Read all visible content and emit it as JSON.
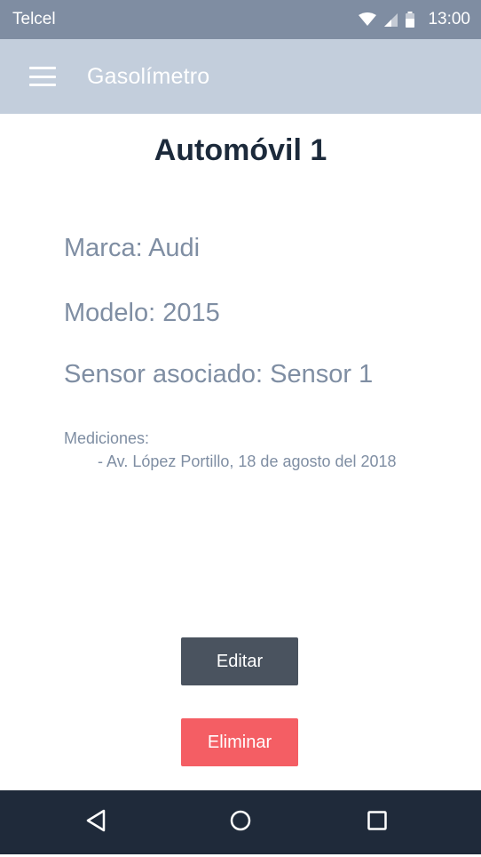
{
  "status_bar": {
    "carrier": "Telcel",
    "time": "13:00",
    "icons": [
      "wifi-icon",
      "signal-icon",
      "battery-icon"
    ]
  },
  "app_bar": {
    "menu_icon": "hamburger-menu-icon",
    "title": "Gasolímetro"
  },
  "main": {
    "title": "Automóvil 1",
    "marca": "Marca: Audi",
    "modelo": "Modelo: 2015",
    "sensor": "Sensor asociado: Sensor 1",
    "mediciones_label": "Mediciones:",
    "mediciones": [
      "- Av. López Portillo, 18 de agosto del 2018"
    ]
  },
  "actions": {
    "edit_label": "Editar",
    "delete_label": "Eliminar"
  },
  "nav_bar": {
    "icons": [
      "back-icon",
      "home-icon",
      "recent-apps-icon"
    ]
  },
  "colors": {
    "status_bar": "#7f8da2",
    "app_bar": "#c3cedc",
    "title_text": "#1c2a3b",
    "field_text": "#7f8ea3",
    "edit_button": "#4a535f",
    "delete_button": "#f45e64",
    "nav_bar": "#1f2a3a"
  }
}
